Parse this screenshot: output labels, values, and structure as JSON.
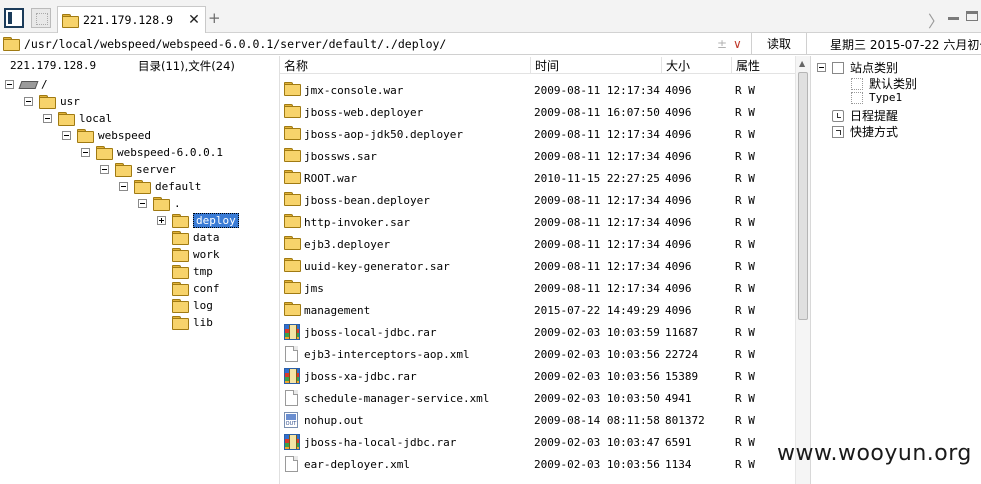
{
  "tabbar": {
    "tab_title": "221.179.128.9",
    "close_glyph": "✕",
    "add_glyph": "+",
    "scroll_glyph": "〉"
  },
  "addressbar": {
    "path": "/usr/local/webspeed/webspeed-6.0.0.1/server/default/./deploy/",
    "star_glyph": "±",
    "dropdown_glyph": "∨",
    "read_label": "读取",
    "date_text": "星期三  2015-07-22  六月初七"
  },
  "tree": {
    "host": "221.179.128.9",
    "counts": "目录(11),文件(24)",
    "nodes": [
      {
        "label": "/",
        "icon": "drive-icon",
        "depth": 0,
        "expander": "minus"
      },
      {
        "label": "usr",
        "icon": "folder-icon",
        "depth": 1,
        "expander": "minus"
      },
      {
        "label": "local",
        "icon": "folder-icon",
        "depth": 2,
        "expander": "minus"
      },
      {
        "label": "webspeed",
        "icon": "folder-icon",
        "depth": 3,
        "expander": "minus"
      },
      {
        "label": "webspeed-6.0.0.1",
        "icon": "folder-icon",
        "depth": 4,
        "expander": "minus"
      },
      {
        "label": "server",
        "icon": "folder-icon",
        "depth": 5,
        "expander": "minus"
      },
      {
        "label": "default",
        "icon": "folder-icon",
        "depth": 6,
        "expander": "minus"
      },
      {
        "label": ".",
        "icon": "folder-icon",
        "depth": 7,
        "expander": "minus"
      },
      {
        "label": "deploy",
        "icon": "folder-icon",
        "depth": 8,
        "expander": "plus",
        "selected": true
      },
      {
        "label": "data",
        "icon": "folder-icon",
        "depth": 8,
        "expander": "none"
      },
      {
        "label": "work",
        "icon": "folder-icon",
        "depth": 8,
        "expander": "none"
      },
      {
        "label": "tmp",
        "icon": "folder-icon",
        "depth": 8,
        "expander": "none"
      },
      {
        "label": "conf",
        "icon": "folder-icon",
        "depth": 8,
        "expander": "none"
      },
      {
        "label": "log",
        "icon": "folder-icon",
        "depth": 8,
        "expander": "none"
      },
      {
        "label": "lib",
        "icon": "folder-icon",
        "depth": 8,
        "expander": "none"
      }
    ]
  },
  "filelist": {
    "columns": {
      "name": "名称",
      "time": "时间",
      "size": "大小",
      "attr": "属性"
    },
    "files": [
      {
        "name": "jmx-console.war",
        "time": "2009-08-11 12:17:34",
        "size": "4096",
        "attr": "R W",
        "icon": "folder-icon"
      },
      {
        "name": "jboss-web.deployer",
        "time": "2009-08-11 16:07:50",
        "size": "4096",
        "attr": "R W",
        "icon": "folder-icon"
      },
      {
        "name": "jboss-aop-jdk50.deployer",
        "time": "2009-08-11 12:17:34",
        "size": "4096",
        "attr": "R W",
        "icon": "folder-icon"
      },
      {
        "name": "jbossws.sar",
        "time": "2009-08-11 12:17:34",
        "size": "4096",
        "attr": "R W",
        "icon": "folder-icon"
      },
      {
        "name": "ROOT.war",
        "time": "2010-11-15 22:27:25",
        "size": "4096",
        "attr": "R W",
        "icon": "folder-icon"
      },
      {
        "name": "jboss-bean.deployer",
        "time": "2009-08-11 12:17:34",
        "size": "4096",
        "attr": "R W",
        "icon": "folder-icon"
      },
      {
        "name": "http-invoker.sar",
        "time": "2009-08-11 12:17:34",
        "size": "4096",
        "attr": "R W",
        "icon": "folder-icon"
      },
      {
        "name": "ejb3.deployer",
        "time": "2009-08-11 12:17:34",
        "size": "4096",
        "attr": "R W",
        "icon": "folder-icon"
      },
      {
        "name": "uuid-key-generator.sar",
        "time": "2009-08-11 12:17:34",
        "size": "4096",
        "attr": "R W",
        "icon": "folder-icon"
      },
      {
        "name": "jms",
        "time": "2009-08-11 12:17:34",
        "size": "4096",
        "attr": "R W",
        "icon": "folder-icon"
      },
      {
        "name": "management",
        "time": "2015-07-22 14:49:29",
        "size": "4096",
        "attr": "R W",
        "icon": "folder-icon"
      },
      {
        "name": "jboss-local-jdbc.rar",
        "time": "2009-02-03 10:03:59",
        "size": "11687",
        "attr": "R W",
        "icon": "rar-icon"
      },
      {
        "name": "ejb3-interceptors-aop.xml",
        "time": "2009-02-03 10:03:56",
        "size": "22724",
        "attr": "R W",
        "icon": "doc-icon"
      },
      {
        "name": "jboss-xa-jdbc.rar",
        "time": "2009-02-03 10:03:56",
        "size": "15389",
        "attr": "R W",
        "icon": "rar-icon"
      },
      {
        "name": "schedule-manager-service.xml",
        "time": "2009-02-03 10:03:50",
        "size": "4941",
        "attr": "R W",
        "icon": "doc-icon"
      },
      {
        "name": "nohup.out",
        "time": "2009-08-14 08:11:58",
        "size": "801372",
        "attr": "R W",
        "icon": "out-icon"
      },
      {
        "name": "jboss-ha-local-jdbc.rar",
        "time": "2009-02-03 10:03:47",
        "size": "6591",
        "attr": "R W",
        "icon": "rar-icon"
      },
      {
        "name": "ear-deployer.xml",
        "time": "2009-02-03 10:03:56",
        "size": "1134",
        "attr": "R W",
        "icon": "doc-icon"
      }
    ]
  },
  "rightpanel": {
    "site_category": "站点类别",
    "default_category": "默认类别",
    "type1": "Type1",
    "schedule": "日程提醒",
    "shortcut": "快捷方式"
  },
  "watermark": "www.wooyun.org",
  "colors": {
    "selection": "#3a7bd5",
    "folder": "#f7d36b",
    "tab_border": "#1b3b5a"
  }
}
